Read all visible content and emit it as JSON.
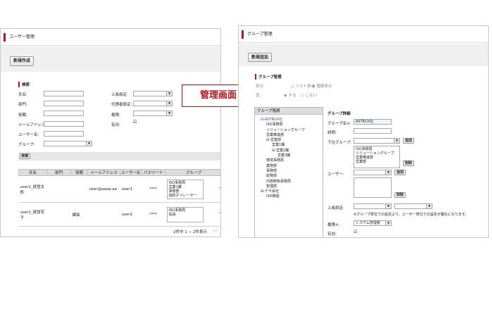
{
  "left": {
    "title": "ユーザー管理",
    "new_button": "新規作成",
    "search_section": "検索",
    "fields": {
      "name": "氏名:",
      "department": "部門:",
      "position": "役職:",
      "email": "メールアドレス:",
      "username": "ユーザー名:",
      "group": "グループ:",
      "superior": "上長設定:",
      "proxy": "代理者設定:",
      "authority": "権限:",
      "valid": "有効:"
    },
    "valid_check": "☑",
    "search_button": "検索",
    "table": {
      "headers": [
        "氏名",
        "部門",
        "役職",
        "メールアドレス",
        "ユーザー名",
        "パスワード",
        "グループ"
      ],
      "rows": [
        {
          "name": "user1_経営太郎",
          "dept": "",
          "position": "",
          "email": "user@aaaa.aa",
          "username": "user1",
          "password": "****",
          "groups": [
            "ISO事務局",
            "営業1課",
            "事務部",
            "指紋オペレーター"
          ],
          "more": "→"
        },
        {
          "name": "user2_経営花子",
          "dept": "",
          "position": "課長",
          "email": "",
          "username": "user2",
          "password": "****",
          "groups": [
            "ISO事務局",
            "役員"
          ],
          "more": "→"
        }
      ]
    },
    "pager": "2件中 1 − 2件表示",
    "pager_icon": "|◁"
  },
  "callout": "管理画面",
  "right": {
    "title": "グループ管理",
    "new_button": "新規追加",
    "group_section": "グループ管理",
    "display_label": "表示:",
    "radio_list": "○ リスト表示",
    "radio_tree": "◉ 階層表示",
    "sort_label": "並:",
    "radio_sort_yes": "◉ する",
    "radio_sort_no": "○ しない",
    "tree_header": "グループ階層",
    "tree_nodes": [
      {
        "t": "⊟-ASTRUX社",
        "i": 0
      },
      {
        "t": "ISO事務局",
        "i": 1
      },
      {
        "t": "ソリューショングループ",
        "i": 1
      },
      {
        "t": "営業推進部",
        "i": 1
      },
      {
        "t": "⊟-営業部",
        "i": 1
      },
      {
        "t": "営業1課",
        "i": 2
      },
      {
        "t": "⊟-営業2課",
        "i": 2
      },
      {
        "t": "営業3課",
        "i": 3
      },
      {
        "t": "環境事務局",
        "i": 1
      },
      {
        "t": "業務部",
        "i": 1
      },
      {
        "t": "事務部",
        "i": 1
      },
      {
        "t": "総務部",
        "i": 1
      },
      {
        "t": "内部統制事務局",
        "i": 1
      },
      {
        "t": "管理部",
        "i": 1
      },
      {
        "t": "⊟-デモ会社",
        "i": 0
      },
      {
        "t": "ISO推進",
        "i": 1
      }
    ],
    "detail_section": "グループ詳細",
    "labels": {
      "group_name": "グループ名",
      "required_mark": "※",
      "description": "説明:",
      "sub_group": "下位グループ:",
      "users": "ユーザー:",
      "superior": "上長設定:",
      "note": "※グループ単位での設定より、ユーザー単位での設定が優先になります。",
      "authority": "権限",
      "valid": "有効:"
    },
    "group_name_value": "ASTRUX社",
    "sub_group_items": [
      "ISO事務局",
      "ソリューショングループ",
      "営業推進部",
      "営業部"
    ],
    "add_label": "追加",
    "delete_label": "削除",
    "authority_value": "システム管理者",
    "colon": ":",
    "valid_check": "☑"
  }
}
